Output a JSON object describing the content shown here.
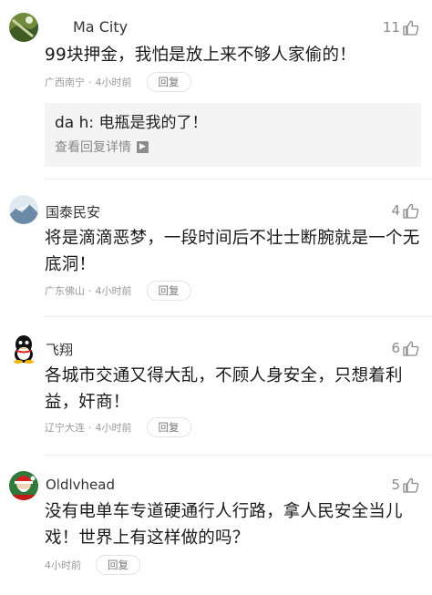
{
  "comments": [
    {
      "username": "Ma City",
      "likes": "11",
      "text": "99块押金，我怕是放上来不够人家偷的！",
      "location": "广西南宁",
      "time": "4小时前",
      "reply_label": "回复",
      "sub_reply": {
        "text": "da   h:  电瓶是我的了！",
        "link": "查看回复详情"
      }
    },
    {
      "username": "国泰民安",
      "likes": "4",
      "text": "将是滴滴恶梦，一段时间后不壮士断腕就是一个无底洞！",
      "location": "广东佛山",
      "time": "4小时前",
      "reply_label": "回复"
    },
    {
      "username": "飞翔",
      "likes": "6",
      "text": "各城市交通又得大乱，不顾人身安全，只想着利益，奸商！",
      "location": "辽宁大连",
      "time": "4小时前",
      "reply_label": "回复"
    },
    {
      "username": "Oldlvhead",
      "likes": "5",
      "text": "没有电单车专道硬通行人行路，拿人民安全当儿戏！世界上有这样做的吗？",
      "location": "",
      "time": "4小时前",
      "reply_label": "回复"
    }
  ],
  "colors": {
    "text": "#1a1a1a",
    "meta": "#9a9a9a",
    "sub_reply_bg": "#f4f4f4"
  },
  "icons": [
    "thumbs-up-icon",
    "chevron-right-icon"
  ]
}
